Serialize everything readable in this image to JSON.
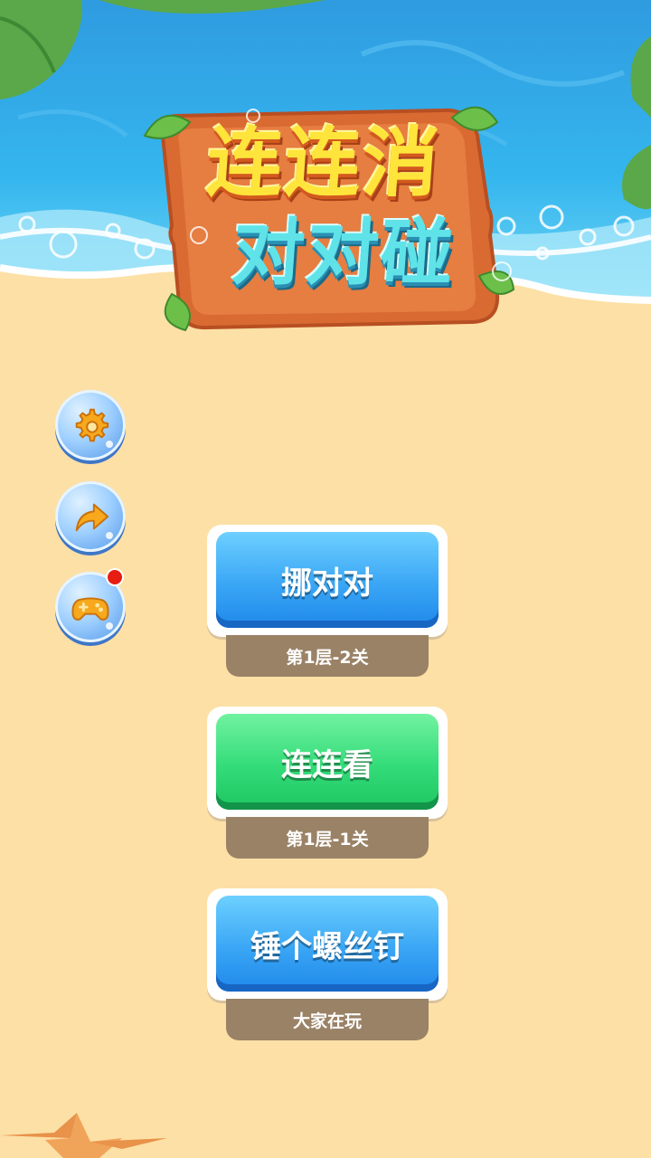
{
  "title": {
    "line1": "连连消",
    "line2": "对对碰"
  },
  "side_buttons": [
    {
      "icon": "gear-icon"
    },
    {
      "icon": "share-arrow-icon"
    },
    {
      "icon": "gamepad-icon",
      "badge": true
    }
  ],
  "games": [
    {
      "label": "挪对对",
      "sub": "第1层-2关",
      "color": "blue"
    },
    {
      "label": "连连看",
      "sub": "第1层-1关",
      "color": "green"
    },
    {
      "label": "锤个螺丝钉",
      "sub": "大家在玩",
      "color": "blue"
    }
  ],
  "colors": {
    "sand": "#fde0a6",
    "sea": "#2aa8e8",
    "logo_wood": "#e0733a",
    "sub_bg": "#9a8266"
  }
}
